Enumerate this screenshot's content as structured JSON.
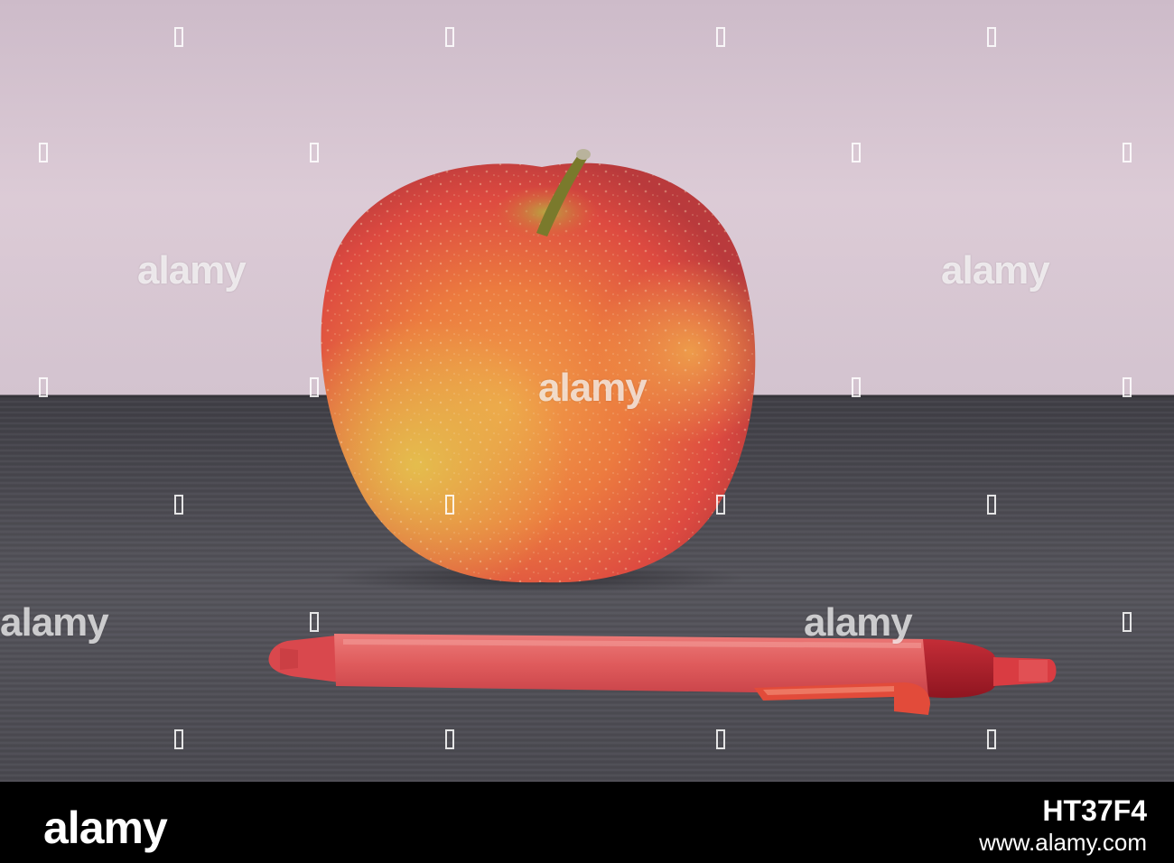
{
  "photo": {
    "subjects": [
      "apple",
      "pen"
    ],
    "colors": {
      "wall": "#d9c8d4",
      "table": "#4e4d54",
      "apple_red": "#d9413d",
      "apple_yellow": "#e8a948",
      "pen_body": "#e0565a",
      "pen_clip": "#e24b3a",
      "pen_grip": "#b01e2a"
    }
  },
  "watermark": {
    "text": "alamy"
  },
  "footer": {
    "logo": "alamy",
    "image_id": "HT37F4",
    "url": "www.alamy.com"
  }
}
